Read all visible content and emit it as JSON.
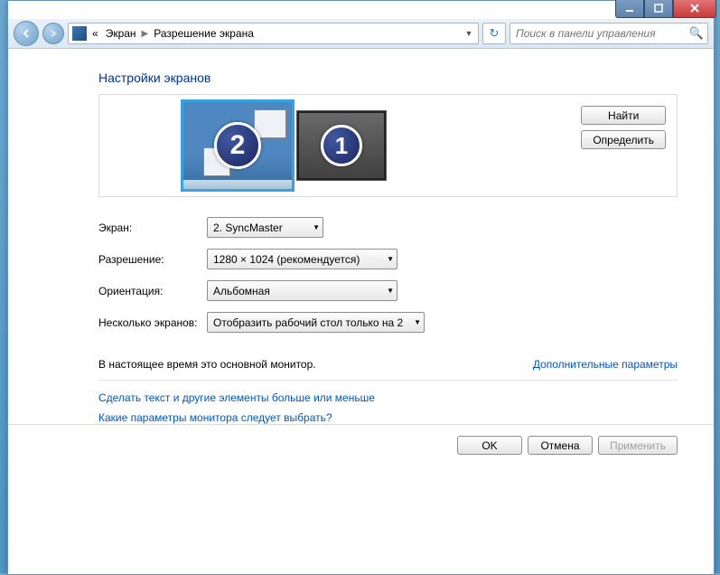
{
  "breadcrumb": {
    "prefix": "«",
    "part1": "Экран",
    "part2": "Разрешение экрана"
  },
  "search": {
    "placeholder": "Поиск в панели управления"
  },
  "page_title": "Настройки экранов",
  "monitors": {
    "m2_number": "2",
    "m1_number": "1"
  },
  "side_buttons": {
    "find": "Найти",
    "identify": "Определить"
  },
  "form": {
    "display_label": "Экран:",
    "display_value": "2. SyncMaster",
    "resolution_label": "Разрешение:",
    "resolution_value": "1280 × 1024 (рекомендуется)",
    "orientation_label": "Ориентация:",
    "orientation_value": "Альбомная",
    "multi_label": "Несколько экранов:",
    "multi_value": "Отобразить рабочий стол только на 2"
  },
  "status": {
    "primary_monitor": "В настоящее время это основной монитор.",
    "advanced_link": "Дополнительные параметры"
  },
  "help": {
    "text_size": "Сделать текст и другие элементы больше или меньше",
    "which_settings": "Какие параметры монитора следует выбрать?"
  },
  "footer": {
    "ok": "OK",
    "cancel": "Отмена",
    "apply": "Применить"
  }
}
